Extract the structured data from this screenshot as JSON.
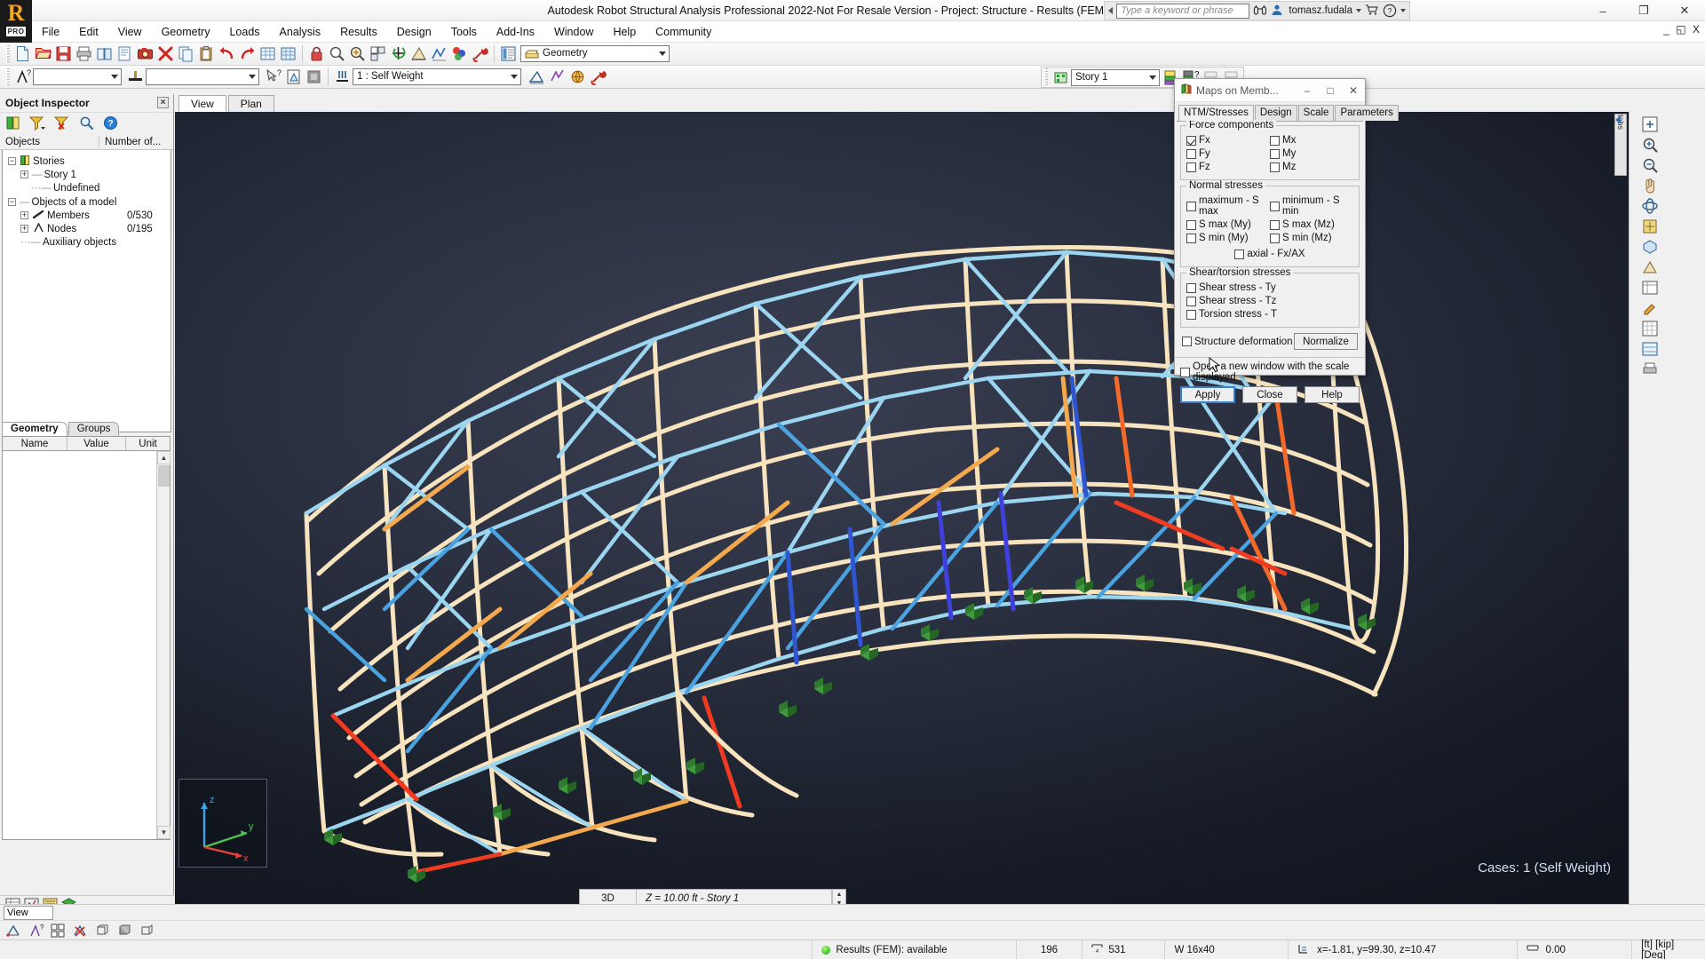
{
  "app": {
    "title": "Autodesk Robot Structural Analysis Professional 2022-Not For Resale Version - Project: Structure - Results (FEM): available",
    "brand_letter": "R",
    "brand_sub": "PRO"
  },
  "titlebar": {
    "search_placeholder": "Type a keyword or phrase",
    "user": "tomasz.fudala",
    "minimize": "–",
    "restore": "❐",
    "close": "✕",
    "mdi_min": "_",
    "mdi_restore": "◱",
    "mdi_close": "X"
  },
  "menu": {
    "items": [
      "File",
      "Edit",
      "View",
      "Geometry",
      "Loads",
      "Analysis",
      "Results",
      "Design",
      "Tools",
      "Add-Ins",
      "Window",
      "Help",
      "Community"
    ]
  },
  "toolbar1": {
    "layout_combo": "Geometry"
  },
  "toolbar2": {
    "combo1": "",
    "combo2": "",
    "loadcase": "1 : Self Weight",
    "combo4": ""
  },
  "story_toolbar": {
    "story": "Story 1"
  },
  "inspector": {
    "title": "Object Inspector",
    "close_label": "×",
    "columns": [
      "Objects",
      "Number of..."
    ],
    "tree": [
      {
        "label": "Stories",
        "count": "",
        "depth": 0,
        "toggle": "−"
      },
      {
        "label": "Story 1",
        "count": "",
        "depth": 1,
        "toggle": "+"
      },
      {
        "label": "Undefined",
        "count": "",
        "depth": 1,
        "toggle": ""
      },
      {
        "label": "Objects of a model",
        "count": "",
        "depth": 0,
        "toggle": "−"
      },
      {
        "label": "Members",
        "count": "0/530",
        "depth": 1,
        "toggle": "+"
      },
      {
        "label": "Nodes",
        "count": "0/195",
        "depth": 1,
        "toggle": "+"
      },
      {
        "label": "Auxiliary objects",
        "count": "",
        "depth": 1,
        "toggle": ""
      }
    ],
    "tabs": [
      {
        "label": "Geometry",
        "active": true
      },
      {
        "label": "Groups",
        "active": false
      }
    ],
    "property_columns": [
      "Name",
      "Value",
      "Unit"
    ],
    "property_rows": []
  },
  "viewport": {
    "tabs": [
      {
        "label": "View",
        "active": true
      },
      {
        "label": "Plan",
        "active": false
      }
    ],
    "cases_label": "Cases: 1 (Self Weight)",
    "view_mode": "3D",
    "level_label": "Z = 10.00 ft - Story 1",
    "spin_up": "▲",
    "spin_down": "▼",
    "axis": {
      "x": "x",
      "y": "y",
      "z": "z"
    },
    "side_tab_label": "tabs",
    "background_hex": "#222836",
    "member_colors": [
      "#f6e2bc",
      "#f5a94f",
      "#9bd5f0",
      "#2f7fd6",
      "#4040d8",
      "#ee3b22",
      "#f4692a"
    ],
    "support_color": "#2f7a2f"
  },
  "dialog": {
    "title": "Maps on Memb...",
    "minimize": "–",
    "maximize": "□",
    "close": "✕",
    "tabs": [
      {
        "label": "NTM/Stresses",
        "active": true
      },
      {
        "label": "Design",
        "active": false
      },
      {
        "label": "Scale",
        "active": false
      },
      {
        "label": "Parameters",
        "active": false
      }
    ],
    "force_components": {
      "legend": "Force components",
      "left": [
        {
          "label": "Fx",
          "checked": true
        },
        {
          "label": "Fy",
          "checked": false
        },
        {
          "label": "Fz",
          "checked": false
        }
      ],
      "right": [
        {
          "label": "Mx",
          "checked": false
        },
        {
          "label": "My",
          "checked": false
        },
        {
          "label": "Mz",
          "checked": false
        }
      ]
    },
    "normal_stresses": {
      "legend": "Normal stresses",
      "left": [
        {
          "label": "maximum - S max",
          "checked": false
        },
        {
          "label": "S max (My)",
          "checked": false
        },
        {
          "label": "S min (My)",
          "checked": false
        }
      ],
      "right": [
        {
          "label": "minimum - S min",
          "checked": false
        },
        {
          "label": "S max (Mz)",
          "checked": false
        },
        {
          "label": "S min (Mz)",
          "checked": false
        }
      ],
      "axial": {
        "label": "axial - Fx/AX",
        "checked": false
      }
    },
    "shear_torsion": {
      "legend": "Shear/torsion stresses",
      "items": [
        {
          "label": "Shear stress - Ty",
          "checked": false
        },
        {
          "label": "Shear stress - Tz",
          "checked": false
        },
        {
          "label": "Torsion stress - T",
          "checked": false
        }
      ]
    },
    "structure_deformation": {
      "label": "Structure deformation",
      "checked": false
    },
    "normalize_button": "Normalize",
    "open_new_window": {
      "label": "Open a new window with the scale displayed",
      "checked": false
    },
    "buttons": {
      "apply": "Apply",
      "close": "Close",
      "help": "Help"
    }
  },
  "commandbar": {
    "value": "View"
  },
  "statusbar": {
    "results": "Results (FEM): available",
    "count1": "196",
    "count2": "531",
    "section": "W 16x40",
    "coords": "x=-1.81, y=99.30, z=10.47",
    "value": "0.00",
    "units": "[ft] [kip] [Deg]"
  }
}
